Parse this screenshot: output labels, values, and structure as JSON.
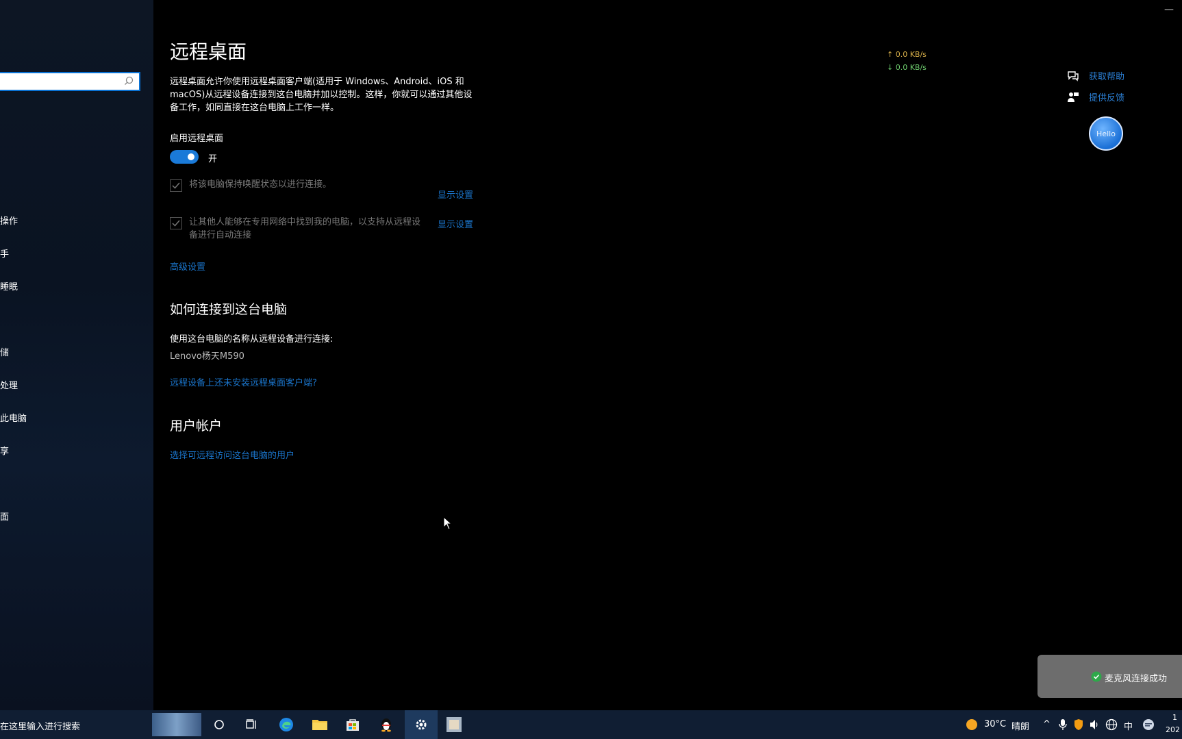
{
  "sidebar": {
    "items": [
      "操作",
      "手",
      "睡眠",
      "储",
      "处理",
      "此电脑",
      "享",
      "",
      "面"
    ]
  },
  "main": {
    "title": "远程桌面",
    "description": "远程桌面允许你使用远程桌面客户端(适用于 Windows、Android、iOS 和 macOS)从远程设备连接到这台电脑并加以控制。这样，你就可以通过其他设备工作，如同直接在这台电脑上工作一样。",
    "enable_label": "启用远程桌面",
    "toggle_state": "开",
    "checkbox1_text": "将该电脑保持唤醒状态以进行连接。",
    "checkbox2_text": "让其他人能够在专用网络中找到我的电脑，以支持从远程设备进行自动连接",
    "show_settings_1": "显示设置",
    "show_settings_2": "显示设置",
    "advanced_settings": "高级设置",
    "how_to_connect_title": "如何连接到这台电脑",
    "use_pc_name": "使用这台电脑的名称从远程设备进行连接:",
    "pc_name": "Lenovo杨天M590",
    "no_client_link": "远程设备上还未安装远程桌面客户端?",
    "user_accounts_title": "用户帐户",
    "select_users_link": "选择可远程访问这台电脑的用户"
  },
  "net_speed": {
    "upload": "↑ 0.0 KB/s",
    "download": "↓ 0.0 KB/s"
  },
  "help": {
    "get_help": "获取帮助",
    "feedback": "提供反馈"
  },
  "avatar_text": "Hello",
  "toast_text": "麦克风连接成功",
  "taskbar": {
    "search_text": "在这里输入进行搜索",
    "weather_temp": "30°C",
    "weather_desc": "晴朗",
    "ime": "中",
    "time_partial": "1",
    "date_partial": "202"
  },
  "colors": {
    "accent": "#1a7ad8",
    "link": "#1a73c8",
    "taskbar": "#101e33"
  }
}
